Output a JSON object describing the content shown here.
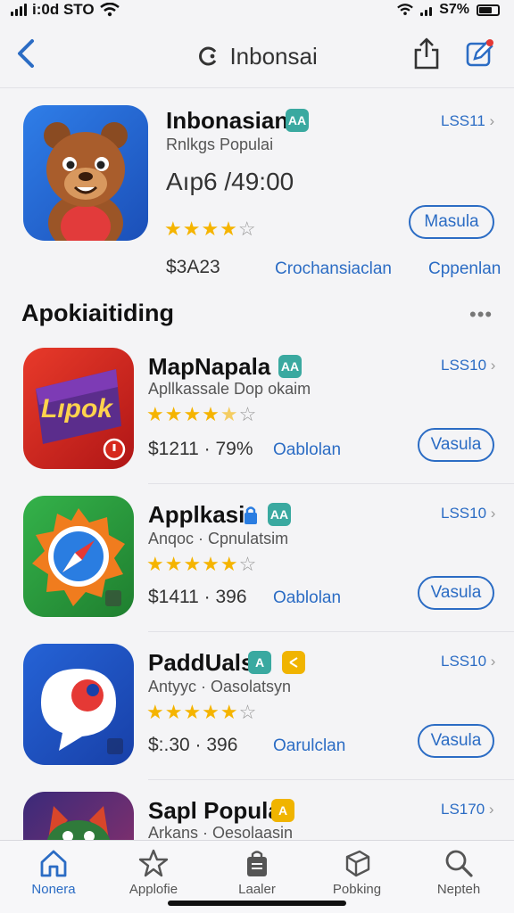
{
  "status": {
    "time": "i:0d STO",
    "battery": "S7%"
  },
  "nav": {
    "title": "Inbonsai"
  },
  "featured": {
    "title": "Inbonasian",
    "subtitle": "Rnlkgs Populai",
    "rating_text": "Aıp6 /49:00",
    "version": "LSS11",
    "stars": "★★★★",
    "stars_empty": "☆",
    "rating": 4,
    "price": "$3A23",
    "link1": "Crochansiaclan",
    "link2": "Cppenlan",
    "button": "Masula",
    "badge": "AA"
  },
  "section": {
    "title": "Apokiaitiding",
    "more": "•••"
  },
  "apps": [
    {
      "title": "MapNapala",
      "subtitle": "Apllkassale Dop okaim",
      "version": "LSS10",
      "stars": "★★★★",
      "stars_half": "★",
      "stars_empty": "☆",
      "rating": 4.5,
      "price": "$1211 · 79%",
      "link": "Oablolan",
      "button": "Vasula",
      "icon_text": "Lıpok",
      "badge": "AA"
    },
    {
      "title": "Applkasi",
      "subtitle": "Anqoc · Cpnulatsim",
      "version": "LSS10",
      "stars": "★★★★★",
      "stars_empty": "☆",
      "rating": 4.5,
      "price": "$1411 · 396",
      "link": "Oablolan",
      "button": "Vasula",
      "badge": "AA"
    },
    {
      "title": "PaddUals",
      "subtitle": "Antyyc · Oasolatsyn",
      "version": "LSS10",
      "stars": "★★★★★",
      "stars_empty": "☆",
      "rating": 4.5,
      "price": "$:.30 · 396",
      "link": "Oarulclan",
      "button": "Vasula",
      "badge": "A"
    },
    {
      "title": "Sapl Popular",
      "subtitle": "Arkans · Oesolaasin",
      "version": "LS170",
      "badge": "A"
    }
  ],
  "tabs": [
    {
      "label": "Nonera",
      "icon": "home-icon",
      "active": true
    },
    {
      "label": "Applofie",
      "icon": "star-icon",
      "active": false
    },
    {
      "label": "Laaler",
      "icon": "bag-icon",
      "active": false
    },
    {
      "label": "Pobking",
      "icon": "cube-icon",
      "active": false
    },
    {
      "label": "Nepteh",
      "icon": "search-icon",
      "active": false
    }
  ],
  "colors": {
    "accent": "#2b6cc4",
    "star": "#f5b400",
    "badge_teal": "#3aa9a0",
    "badge_yellow": "#f0b400"
  }
}
